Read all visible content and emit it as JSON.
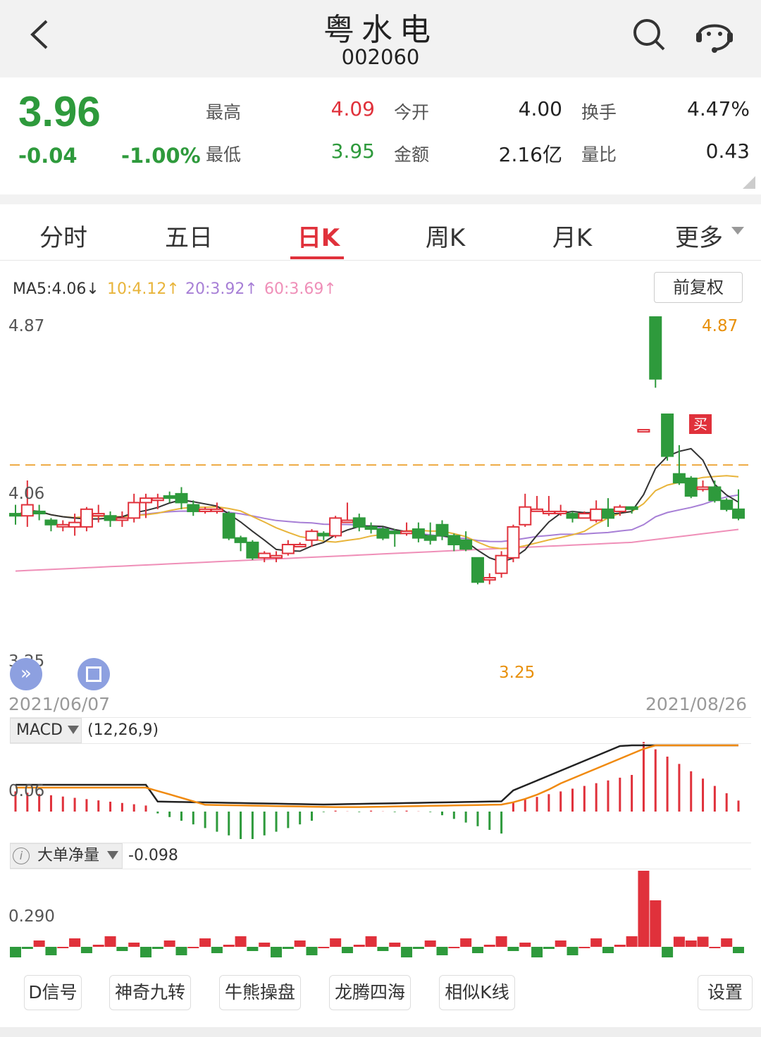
{
  "header": {
    "title": "粤水电",
    "code": "002060"
  },
  "quote": {
    "price": "3.96",
    "change": "-0.04",
    "change_pct": "-1.00%",
    "high_label": "最高",
    "high": "4.09",
    "low_label": "最低",
    "low": "3.95",
    "open_label": "今开",
    "open": "4.00",
    "amount_label": "金额",
    "amount": "2.16亿",
    "turnover_label": "换手",
    "turnover": "4.47%",
    "vol_ratio_label": "量比",
    "vol_ratio": "0.43"
  },
  "tabs": [
    {
      "label": "分时"
    },
    {
      "label": "五日"
    },
    {
      "label": "日K"
    },
    {
      "label": "周K"
    },
    {
      "label": "月K"
    },
    {
      "label": "更多"
    }
  ],
  "ma": {
    "ma5": "MA5:4.06↓",
    "ma10": "10:4.12↑",
    "ma20": "20:3.92↑",
    "ma60": "60:3.69↑",
    "fq_button": "前复权"
  },
  "axis": {
    "y_top": "4.87",
    "y_mid": "4.06",
    "y_bot": "3.25",
    "date_start": "2021/06/07",
    "date_end": "2021/08/26",
    "max_label": "4.87",
    "min_label": "3.25",
    "buy_marker": "买"
  },
  "macd": {
    "selector": "MACD",
    "params": "(12,26,9)",
    "y_label": "0.06"
  },
  "bigorder": {
    "selector": "大单净量",
    "value": "-0.098",
    "y_label": "0.290"
  },
  "toolbar": [
    {
      "label": "D信号"
    },
    {
      "label": "神奇九转"
    },
    {
      "label": "牛熊操盘"
    },
    {
      "label": "龙腾四海"
    },
    {
      "label": "相似K线"
    },
    {
      "label": "设置"
    }
  ],
  "colors": {
    "up": "#e0313b",
    "down": "#2e9a3c",
    "ma5": "#333333",
    "ma10": "#e8b43a",
    "ma20": "#a77fd6",
    "ma60": "#ef8fb8"
  },
  "chart_data": {
    "type": "candlestick",
    "y_range": [
      3.25,
      4.87
    ],
    "candles": [
      [
        3.98,
        3.97,
        4.02,
        3.93
      ],
      [
        3.97,
        4.02,
        4.13,
        3.92
      ],
      [
        3.99,
        3.98,
        4.02,
        3.95
      ],
      [
        3.95,
        3.93,
        3.96,
        3.9
      ],
      [
        3.93,
        3.93,
        3.95,
        3.9
      ],
      [
        3.92,
        3.94,
        3.98,
        3.88
      ],
      [
        3.92,
        4.0,
        4.01,
        3.9
      ],
      [
        3.98,
        3.98,
        4.02,
        3.94
      ],
      [
        3.97,
        3.95,
        3.99,
        3.92
      ],
      [
        3.95,
        3.96,
        3.99,
        3.92
      ],
      [
        3.96,
        4.03,
        4.07,
        3.94
      ],
      [
        4.03,
        4.05,
        4.07,
        3.96
      ],
      [
        4.04,
        4.05,
        4.07,
        4.0
      ],
      [
        4.06,
        4.05,
        4.08,
        4.03
      ],
      [
        4.07,
        4.03,
        4.1,
        4.0
      ],
      [
        4.02,
        3.99,
        4.04,
        3.97
      ],
      [
        3.99,
        4.0,
        4.01,
        3.98
      ],
      [
        4.0,
        4.0,
        4.03,
        3.98
      ],
      [
        3.98,
        3.87,
        3.99,
        3.86
      ],
      [
        3.87,
        3.85,
        3.88,
        3.81
      ],
      [
        3.85,
        3.78,
        3.86,
        3.77
      ],
      [
        3.78,
        3.8,
        3.81,
        3.76
      ],
      [
        3.78,
        3.79,
        3.81,
        3.76
      ],
      [
        3.8,
        3.84,
        3.86,
        3.79
      ],
      [
        3.84,
        3.84,
        3.85,
        3.83
      ],
      [
        3.86,
        3.9,
        3.91,
        3.83
      ],
      [
        3.89,
        3.88,
        3.9,
        3.86
      ],
      [
        3.88,
        3.96,
        3.97,
        3.87
      ],
      [
        3.95,
        3.95,
        4.03,
        3.94
      ],
      [
        3.96,
        3.92,
        3.98,
        3.9
      ],
      [
        3.92,
        3.91,
        3.94,
        3.89
      ],
      [
        3.91,
        3.87,
        3.92,
        3.86
      ],
      [
        3.9,
        3.89,
        3.91,
        3.83
      ],
      [
        3.89,
        3.9,
        3.94,
        3.88
      ],
      [
        3.91,
        3.87,
        3.94,
        3.85
      ],
      [
        3.88,
        3.86,
        3.94,
        3.84
      ],
      [
        3.93,
        3.88,
        3.95,
        3.86
      ],
      [
        3.88,
        3.84,
        3.89,
        3.81
      ],
      [
        3.86,
        3.82,
        3.9,
        3.81
      ],
      [
        3.78,
        3.67,
        3.78,
        3.66
      ],
      [
        3.68,
        3.69,
        3.71,
        3.66
      ],
      [
        3.71,
        3.79,
        3.81,
        3.69
      ],
      [
        3.78,
        3.92,
        3.93,
        3.76
      ],
      [
        3.93,
        4.01,
        4.07,
        3.92
      ],
      [
        4.0,
        4.0,
        4.06,
        3.99
      ],
      [
        3.99,
        3.99,
        4.06,
        3.97
      ],
      [
        3.99,
        3.99,
        4.02,
        3.97
      ],
      [
        3.98,
        3.96,
        3.99,
        3.94
      ],
      [
        3.96,
        3.98,
        3.99,
        3.96
      ],
      [
        3.95,
        4.0,
        4.04,
        3.94
      ],
      [
        4.0,
        3.96,
        4.05,
        3.92
      ],
      [
        3.99,
        4.01,
        4.02,
        3.97
      ],
      [
        4.01,
        4.0,
        4.01,
        3.98
      ],
      [
        4.36,
        4.36,
        4.36,
        4.36
      ],
      [
        4.87,
        4.59,
        4.87,
        4.55
      ],
      [
        4.43,
        4.24,
        4.43,
        4.22
      ],
      [
        4.16,
        4.12,
        4.29,
        4.11
      ],
      [
        4.14,
        4.06,
        4.15,
        4.05
      ],
      [
        4.09,
        4.1,
        4.13,
        4.08
      ],
      [
        4.1,
        4.04,
        4.13,
        4.03
      ],
      [
        4.04,
        4.0,
        4.05,
        3.99
      ],
      [
        4.0,
        3.96,
        4.09,
        3.95
      ]
    ],
    "macd": {
      "dif_last": 0.06,
      "bars_note": "histogram"
    },
    "bigorder": {
      "last": -0.098
    }
  }
}
